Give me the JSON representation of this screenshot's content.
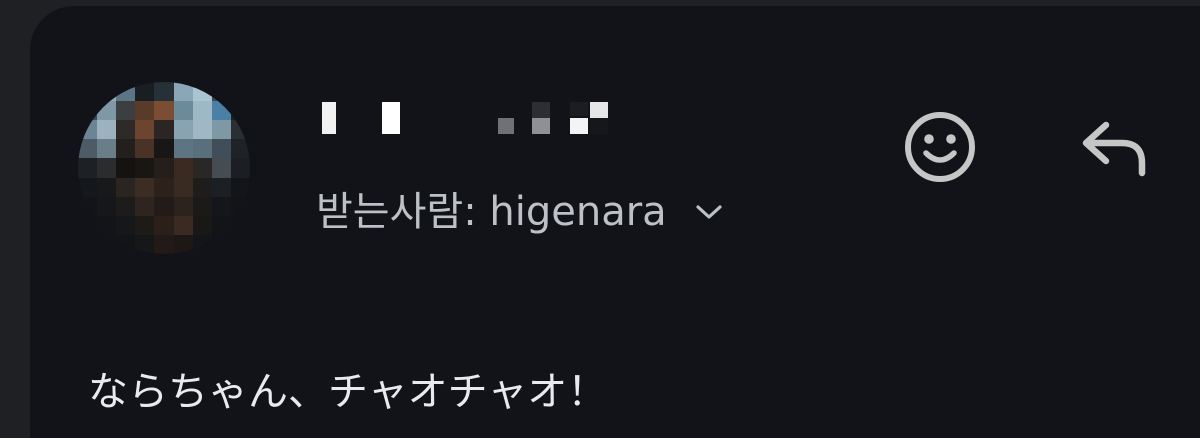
{
  "message_header": {
    "recipient_label": "받는사람: higenara"
  },
  "message_body": {
    "text": "ならちゃん、チャオチャオ！"
  },
  "icons": {
    "avatar": "avatar-pixelated",
    "recipient_details": "chevron-down-icon",
    "add_reaction": "smiley-face-icon",
    "reply": "reply-arrow-icon"
  },
  "colors": {
    "card_background": "#111318",
    "outer_background": "#1f2023",
    "primary_text": "#e8eaed",
    "secondary_text": "#bdc1c6",
    "icon": "#c4c7c5"
  }
}
